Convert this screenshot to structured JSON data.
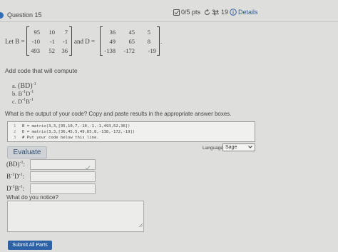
{
  "question": {
    "title": "Question 15",
    "points": "0/5 pts",
    "retries": "3",
    "tries": "19",
    "details": "Details"
  },
  "statement": {
    "let_b": "Let B =",
    "and_d": "and D =",
    "period": ".",
    "matrix_b": [
      [
        "95",
        "10",
        "7"
      ],
      [
        "-10",
        "-1",
        "-1"
      ],
      [
        "493",
        "52",
        "36"
      ]
    ],
    "matrix_d": [
      [
        "36",
        "45",
        "5"
      ],
      [
        "49",
        "65",
        "8"
      ],
      [
        "-138",
        "-172",
        "-19"
      ]
    ]
  },
  "instructions": {
    "add_code": "Add code that will compute",
    "item_a_label": "a.",
    "item_a_expr": "(BD)",
    "item_a_sup": "-1",
    "item_b_label": "b.",
    "item_b_expr1": "B",
    "item_b_sup1": "-1",
    "item_b_expr2": "D",
    "item_b_sup2": "-1",
    "item_c_label": "c.",
    "item_c_expr1": "D",
    "item_c_sup1": "-1",
    "item_c_expr2": "B",
    "item_c_sup2": "-1",
    "output_prompt": "What is the output of your code? Copy and paste results in the appropriate answer boxes."
  },
  "code": {
    "line_numbers": [
      "1",
      "2",
      "3"
    ],
    "lines": [
      "B = matrix(3,3,[95,10,7,-10,-1,-1,493,52,36])",
      "D = matrix(3,3,[36,45,5,49,65,8,-138,-172,-19])",
      "# Put your code below this line."
    ]
  },
  "toolbar": {
    "evaluate_label": "Evaluate",
    "language_label": "Language:",
    "language_value": "Sage"
  },
  "answers": {
    "a_expr": "(BD)",
    "a_sup": "-1",
    "b_expr1": "B",
    "b_sup1": "-1",
    "b_expr2": "D",
    "b_sup2": "-1",
    "c_expr1": "D",
    "c_sup1": "-1",
    "c_expr2": "B",
    "c_sup2": "-1",
    "colon": ":"
  },
  "notice": {
    "prompt": "What do you notice?"
  },
  "submit": {
    "label": "Submit All Parts"
  },
  "colors": {
    "background": "#dedfdd",
    "accent": "#2d63a6",
    "evaluate_bg": "#cfd3d8"
  }
}
